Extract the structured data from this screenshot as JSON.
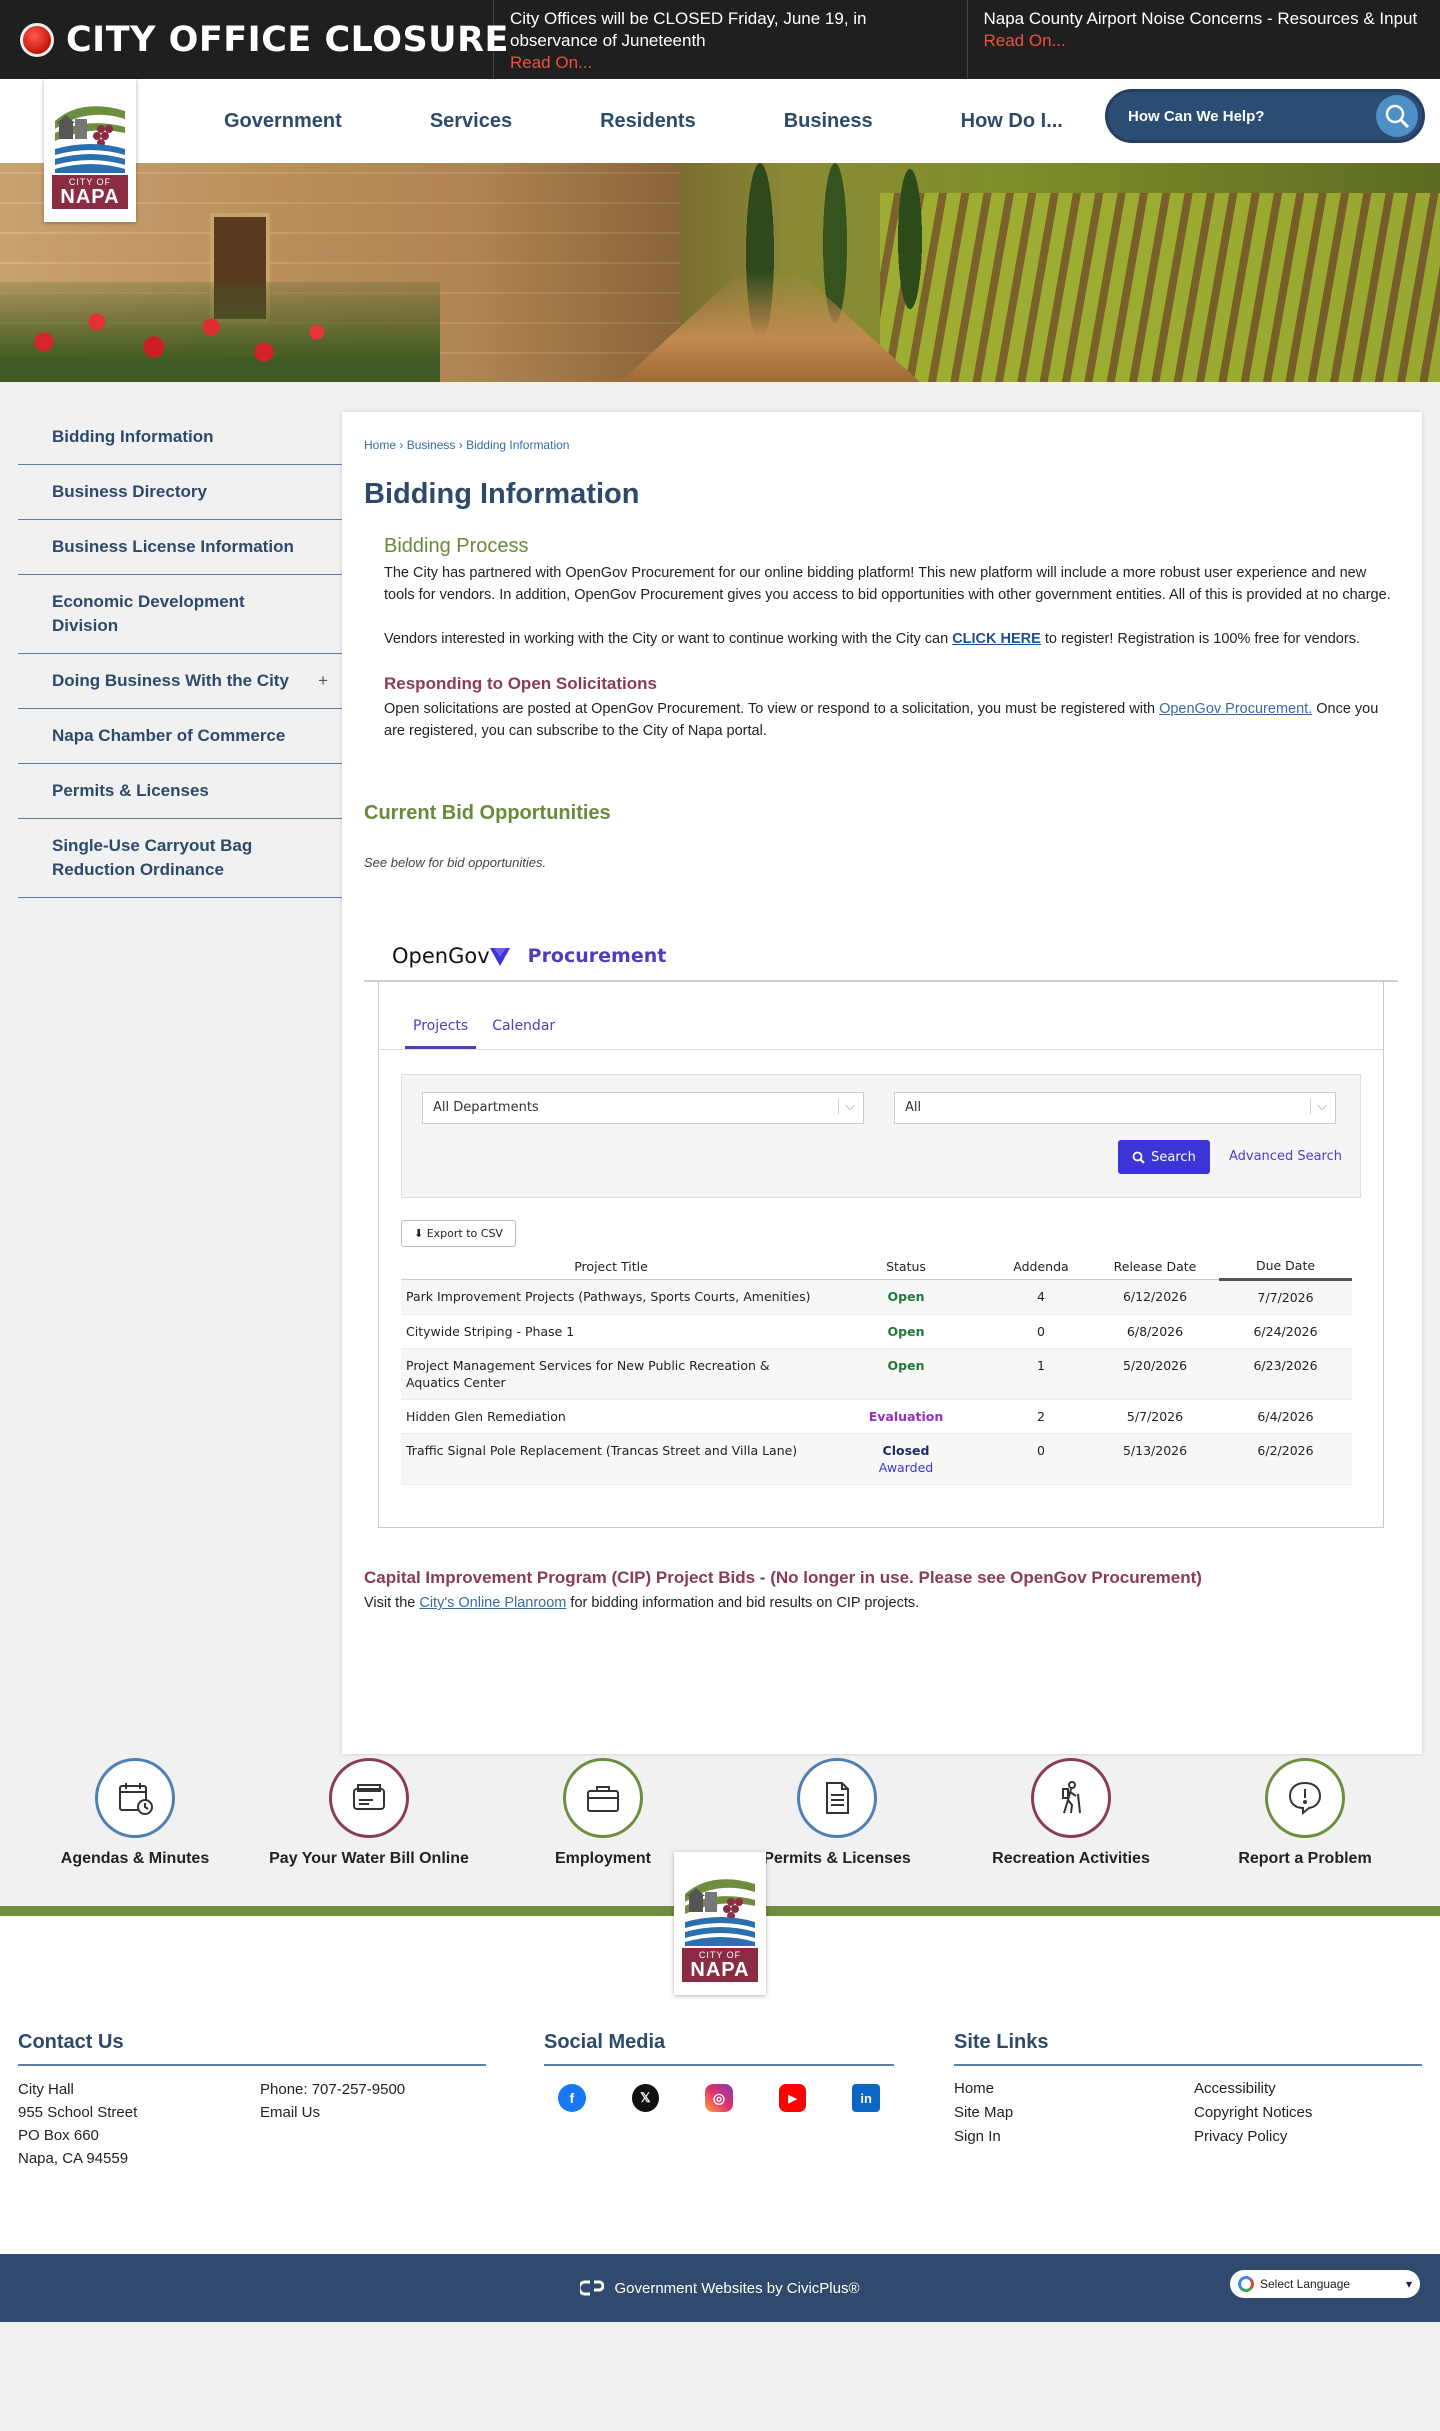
{
  "alert": {
    "title": "CITY OFFICE CLOSURE",
    "items": [
      {
        "text": "City Offices will be CLOSED Friday, June 19, in observance of Juneteenth",
        "link": "Read On..."
      },
      {
        "text": "Napa County Airport Noise Concerns - Resources & Input",
        "link": "Read On..."
      }
    ]
  },
  "logo": {
    "city_of": "CITY OF",
    "napa": "NAPA"
  },
  "nav": [
    "Government",
    "Services",
    "Residents",
    "Business",
    "How Do I..."
  ],
  "search": {
    "placeholder": "How Can We Help?"
  },
  "sidebar": [
    {
      "label": "Bidding Information"
    },
    {
      "label": "Business Directory"
    },
    {
      "label": "Business License Information"
    },
    {
      "label": "Economic Development Division"
    },
    {
      "label": "Doing Business With the City",
      "expander": "+"
    },
    {
      "label": "Napa Chamber of Commerce"
    },
    {
      "label": "Permits & Licenses"
    },
    {
      "label": "Single-Use Carryout Bag Reduction Ordinance"
    }
  ],
  "breadcrumb": {
    "home": "Home",
    "sep": " › ",
    "business": "Business",
    "current": "Bidding Information"
  },
  "page_title": "Bidding Information",
  "bidding": {
    "heading": "Bidding Process",
    "p1": "The City has partnered with OpenGov Procurement for our online bidding platform! This new platform will include a more robust user experience and new tools for vendors. In addition, OpenGov Procurement gives you access to bid opportunities with other government entities. All of this is provided at no charge.",
    "p2_before": "Vendors interested in working with the City or want to continue working with the City can ",
    "p2_link": "CLICK HERE",
    "p2_after": " to register! Registration is 100% free for vendors."
  },
  "responding": {
    "heading": "Responding to Open Solicitations",
    "before": "Open solicitations are posted at OpenGov Procurement.  To view or respond to a solicitation, you must be registered with ",
    "link": "OpenGov Procurement.",
    "after": " Once you are registered, you can subscribe to the City of Napa portal."
  },
  "current": {
    "heading": "Current Bid Opportunities",
    "note": "See below for bid opportunities."
  },
  "opengov": {
    "brand": "OpenGov",
    "product": "Procurement",
    "tabs": [
      "Projects",
      "Calendar"
    ],
    "dept_select": "All Departments",
    "status_select": "All",
    "search_btn": "Search",
    "advanced": "Advanced Search",
    "export": "Export to CSV",
    "columns": [
      "Project Title",
      "Status",
      "Addenda",
      "Release Date",
      "Due Date"
    ],
    "rows": [
      {
        "title": "Park Improvement Projects (Pathways, Sports Courts, Amenities)",
        "status": "Open",
        "status_sub": "",
        "addenda": "4",
        "release": "6/12/2026",
        "due": "7/7/2026"
      },
      {
        "title": "Citywide Striping - Phase 1",
        "status": "Open",
        "status_sub": "",
        "addenda": "0",
        "release": "6/8/2026",
        "due": "6/24/2026"
      },
      {
        "title": "Project Management Services for New Public Recreation & Aquatics Center",
        "status": "Open",
        "status_sub": "",
        "addenda": "1",
        "release": "5/20/2026",
        "due": "6/23/2026"
      },
      {
        "title": "Hidden Glen Remediation",
        "status": "Evaluation",
        "status_sub": "",
        "addenda": "2",
        "release": "5/7/2026",
        "due": "6/4/2026"
      },
      {
        "title": "Traffic Signal Pole Replacement (Trancas Street and Villa Lane)",
        "status": "Closed",
        "status_sub": "Awarded",
        "addenda": "0",
        "release": "5/13/2026",
        "due": "6/2/2026"
      }
    ]
  },
  "cip": {
    "heading": "Capital Improvement Program (CIP) Project Bids - (No longer in use. Please see OpenGov Procurement)",
    "before": "Visit the ",
    "link": "City's Online Planroom",
    "after": " for bidding information and bid results on CIP projects."
  },
  "quick_links": [
    {
      "label": "Agendas & Minutes",
      "icon": "calendar-clock-icon",
      "color": "#4e7fb5"
    },
    {
      "label": "Pay Your Water Bill Online",
      "icon": "wallet-icon",
      "color": "#8a3b55"
    },
    {
      "label": "Employment",
      "icon": "briefcase-icon",
      "color": "#6c8e3e"
    },
    {
      "label": "Permits & Licenses",
      "icon": "document-icon",
      "color": "#4e7fb5"
    },
    {
      "label": "Recreation Activities",
      "icon": "hiker-icon",
      "color": "#8a3b55"
    },
    {
      "label": "Report a Problem",
      "icon": "alert-bubble-icon",
      "color": "#6c8e3e"
    }
  ],
  "footer": {
    "contact": {
      "title": "Contact Us",
      "address": [
        "City Hall",
        "955 School Street",
        "PO Box 660",
        "Napa, CA 94559"
      ],
      "phone": "Phone: 707-257-9500",
      "email": "Email Us"
    },
    "social": {
      "title": "Social Media",
      "icons": [
        "facebook-icon",
        "x-icon",
        "instagram-icon",
        "youtube-icon",
        "linkedin-icon"
      ]
    },
    "site_links": {
      "title": "Site Links",
      "links": [
        "Home",
        "Accessibility",
        "Site Map",
        "Copyright Notices",
        "Sign In",
        "Privacy Policy"
      ]
    }
  },
  "bottom": {
    "credit": "Government Websites by CivicPlus®",
    "language": "Select Language"
  }
}
